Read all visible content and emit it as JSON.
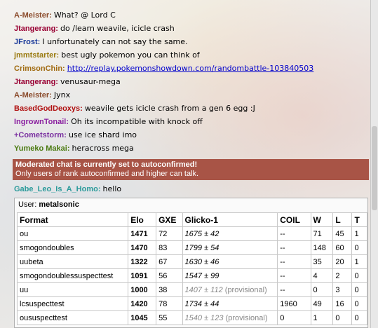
{
  "chat": [
    {
      "user": "A-Meister:",
      "color": "#8a4a2a",
      "msg": "What? @ Lord C"
    },
    {
      "user": "Jtangerang:",
      "color": "#990033",
      "msg": "do /learn weavile, icicle crash"
    },
    {
      "user": "JFrost:",
      "color": "#1a3a9a",
      "msg": "I unfortunately can not say the same."
    },
    {
      "user": "jmmtstarter:",
      "color": "#9a7a10",
      "msg": "best ugly pokemon you can think of"
    },
    {
      "user": "CrimsonChin:",
      "color": "#a06a10",
      "msg": "http://replay.pokemonshowdown.com/randombattle-103840503",
      "link": true
    },
    {
      "user": "Jtangerang:",
      "color": "#990033",
      "msg": "venusaur-mega"
    },
    {
      "user": "A-Meister:",
      "color": "#8a4a2a",
      "msg": "Jynx"
    },
    {
      "user": "BasedGodDeoxys:",
      "color": "#b01010",
      "msg": "weavile gets icicle crash from a gen 6 egg :J"
    },
    {
      "user": "IngrownTonail:",
      "color": "#8a20a0",
      "msg": "Oh its incompatible with knock off"
    },
    {
      "user": "+Cometstorm:",
      "color": "#7a30a0",
      "msg": "use ice shard imo"
    },
    {
      "user": "Yumeko Makai:",
      "color": "#4a7a10",
      "msg": "heracross mega"
    }
  ],
  "moderated": {
    "title": "Moderated chat is currently set to autoconfirmed!",
    "subtitle": "Only users of rank autoconfirmed and higher can talk."
  },
  "last_line": {
    "user": "Gabe_Leo_Is_A_Homo:",
    "color": "#2a9a9a",
    "msg": "hello"
  },
  "stats": {
    "user_label": "User:",
    "username": "metalsonic",
    "headers": [
      "Format",
      "Elo",
      "GXE",
      "Glicko-1",
      "COIL",
      "W",
      "L",
      "T"
    ],
    "rows": [
      [
        "ou",
        "1471",
        "72",
        "1675 ± 42",
        "",
        "--",
        "71",
        "45",
        "1"
      ],
      [
        "smogondoubles",
        "1470",
        "83",
        "1799 ± 54",
        "",
        "--",
        "148",
        "60",
        "0"
      ],
      [
        "uubeta",
        "1322",
        "67",
        "1630 ± 46",
        "",
        "--",
        "35",
        "20",
        "1"
      ],
      [
        "smogondoublessuspecttest",
        "1091",
        "56",
        "1547 ± 99",
        "",
        "--",
        "4",
        "2",
        "0"
      ],
      [
        "uu",
        "1000",
        "38",
        "1407 ± 112",
        "(provisional)",
        "--",
        "0",
        "3",
        "0"
      ],
      [
        "lcsuspecttest",
        "1420",
        "78",
        "1734 ± 44",
        "",
        "1960",
        "49",
        "16",
        "0"
      ],
      [
        "oususpecttest",
        "1045",
        "55",
        "1540 ± 123",
        "(provisional)",
        "0",
        "1",
        "0",
        "0"
      ]
    ]
  }
}
